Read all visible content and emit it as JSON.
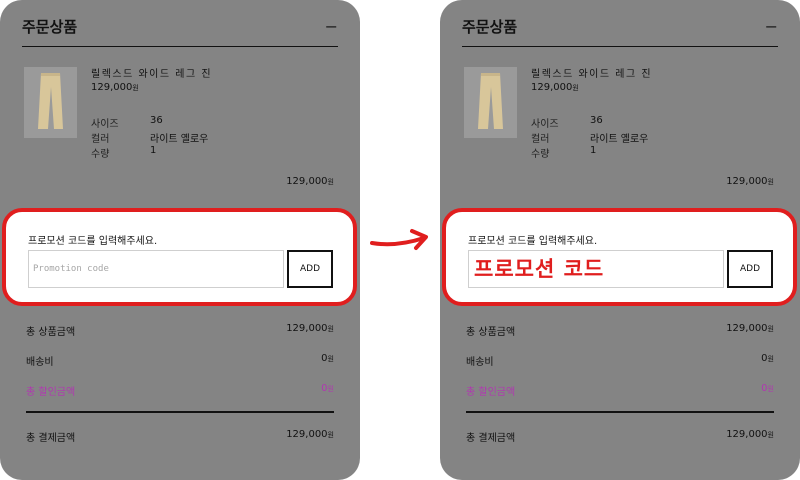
{
  "panels": {
    "left": {
      "header": {
        "title": "주문상품",
        "collapse_icon": "−"
      },
      "product": {
        "name": "릴렉스드 와이드 레그 진",
        "price": "129,000",
        "currency": "원",
        "options": [
          {
            "label": "사이즈",
            "value": "36"
          },
          {
            "label": "컬러",
            "value": "라이트 옐로우"
          },
          {
            "label": "수량",
            "value": "1"
          }
        ],
        "subtotal": "129,000"
      },
      "promo": {
        "label": "프로모션 코드를 입력해주세요.",
        "placeholder": "Promotion code",
        "value": "",
        "add_label": "ADD"
      },
      "summary": {
        "product_total_label": "총 상품금액",
        "product_total_value": "129,000",
        "shipping_label": "배송비",
        "shipping_value": "0",
        "discount_label": "총 할인금액",
        "discount_value": "0",
        "payment_total_label": "총 결제금액",
        "payment_total_value": "129,000"
      }
    },
    "right": {
      "header": {
        "title": "주문상품",
        "collapse_icon": "−"
      },
      "product": {
        "name": "릴렉스드 와이드 레그 진",
        "price": "129,000",
        "currency": "원",
        "options": [
          {
            "label": "사이즈",
            "value": "36"
          },
          {
            "label": "컬러",
            "value": "라이트 옐로우"
          },
          {
            "label": "수량",
            "value": "1"
          }
        ],
        "subtotal": "129,000"
      },
      "promo": {
        "label": "프로모션 코드를 입력해주세요.",
        "placeholder": "",
        "value": "",
        "add_label": "ADD",
        "overlay_text": "프로모션 코드"
      },
      "summary": {
        "product_total_label": "총 상품금액",
        "product_total_value": "129,000",
        "shipping_label": "배송비",
        "shipping_value": "0",
        "discount_label": "총 할인금액",
        "discount_value": "0",
        "payment_total_label": "총 결제금액",
        "payment_total_value": "129,000"
      }
    }
  },
  "colors": {
    "panel_bg": "#848484",
    "highlight_red": "#e01e1e",
    "discount_purple": "#b038b0",
    "product_beige": "#d8c69a"
  },
  "icons": {
    "flow_arrow": "arrow-right-icon",
    "collapse": "minus-icon"
  }
}
